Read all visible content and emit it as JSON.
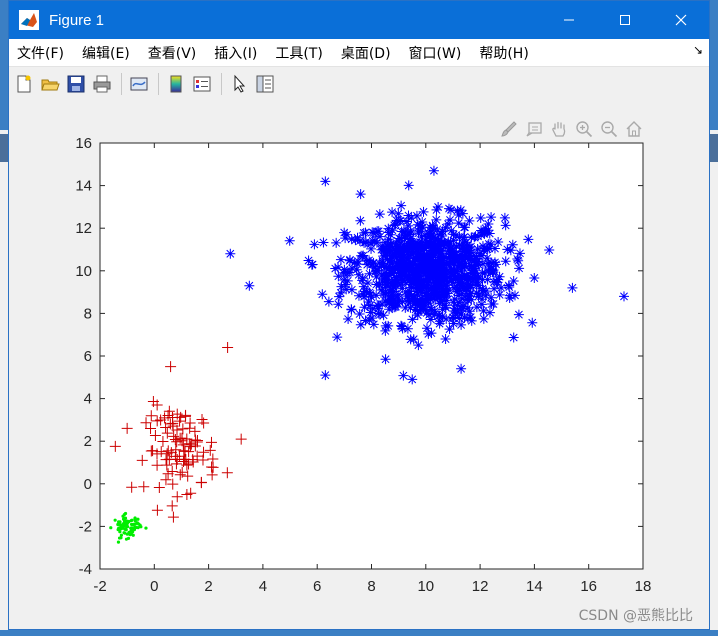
{
  "window": {
    "title": "Figure 1"
  },
  "menu": [
    "文件(F)",
    "编辑(E)",
    "查看(V)",
    "插入(I)",
    "工具(T)",
    "桌面(D)",
    "窗口(W)",
    "帮助(H)"
  ],
  "menu_corner": "↘",
  "toolbar_icons": [
    "new-figure-icon",
    "open-file-icon",
    "save-icon",
    "print-icon",
    "link-plot-icon",
    "colorbar-icon",
    "legend-icon",
    "pointer-icon",
    "property-inspector-icon"
  ],
  "axes_toolbar_icons": [
    "brush-icon",
    "data-tips-icon",
    "pan-hand-icon",
    "zoom-in-icon",
    "zoom-out-icon",
    "home-icon"
  ],
  "watermark": "CSDN @恶熊比比",
  "colors": {
    "blue": "#0000ff",
    "red": "#cc0000",
    "green": "#00ee00"
  },
  "chart_data": {
    "type": "scatter",
    "xlim": [
      -2,
      18
    ],
    "ylim": [
      -4,
      16
    ],
    "xticks": [
      "-2",
      "0",
      "2",
      "4",
      "6",
      "8",
      "10",
      "12",
      "14",
      "16",
      "18"
    ],
    "yticks": [
      "-4",
      "-2",
      "0",
      "2",
      "4",
      "6",
      "8",
      "10",
      "12",
      "14",
      "16"
    ],
    "grid": false,
    "series": [
      {
        "marker": "*",
        "color": "#0000ff",
        "count": 1000,
        "center": [
          10,
          10
        ],
        "spread": [
          2.0,
          1.7
        ],
        "outliers": [
          [
            17.3,
            8.8
          ],
          [
            15.4,
            9.2
          ],
          [
            2.8,
            10.8
          ],
          [
            3.5,
            9.3
          ],
          [
            6.3,
            5.1
          ],
          [
            9.5,
            4.9
          ],
          [
            11.3,
            5.4
          ],
          [
            7.6,
            13.6
          ],
          [
            10.3,
            14.7
          ],
          [
            6.3,
            14.2
          ]
        ]
      },
      {
        "marker": "+",
        "color": "#cc0000",
        "count": 100,
        "center": [
          1,
          1.6
        ],
        "spread": [
          0.9,
          1.4
        ],
        "outliers": [
          [
            2.7,
            6.4
          ],
          [
            0.6,
            5.5
          ],
          [
            3.2,
            2.1
          ],
          [
            -1.0,
            2.6
          ],
          [
            1.2,
            -0.5
          ]
        ]
      },
      {
        "marker": ".",
        "color": "#00ee00",
        "count": 80,
        "center": [
          -1,
          -2
        ],
        "spread": [
          0.35,
          0.35
        ]
      }
    ]
  }
}
